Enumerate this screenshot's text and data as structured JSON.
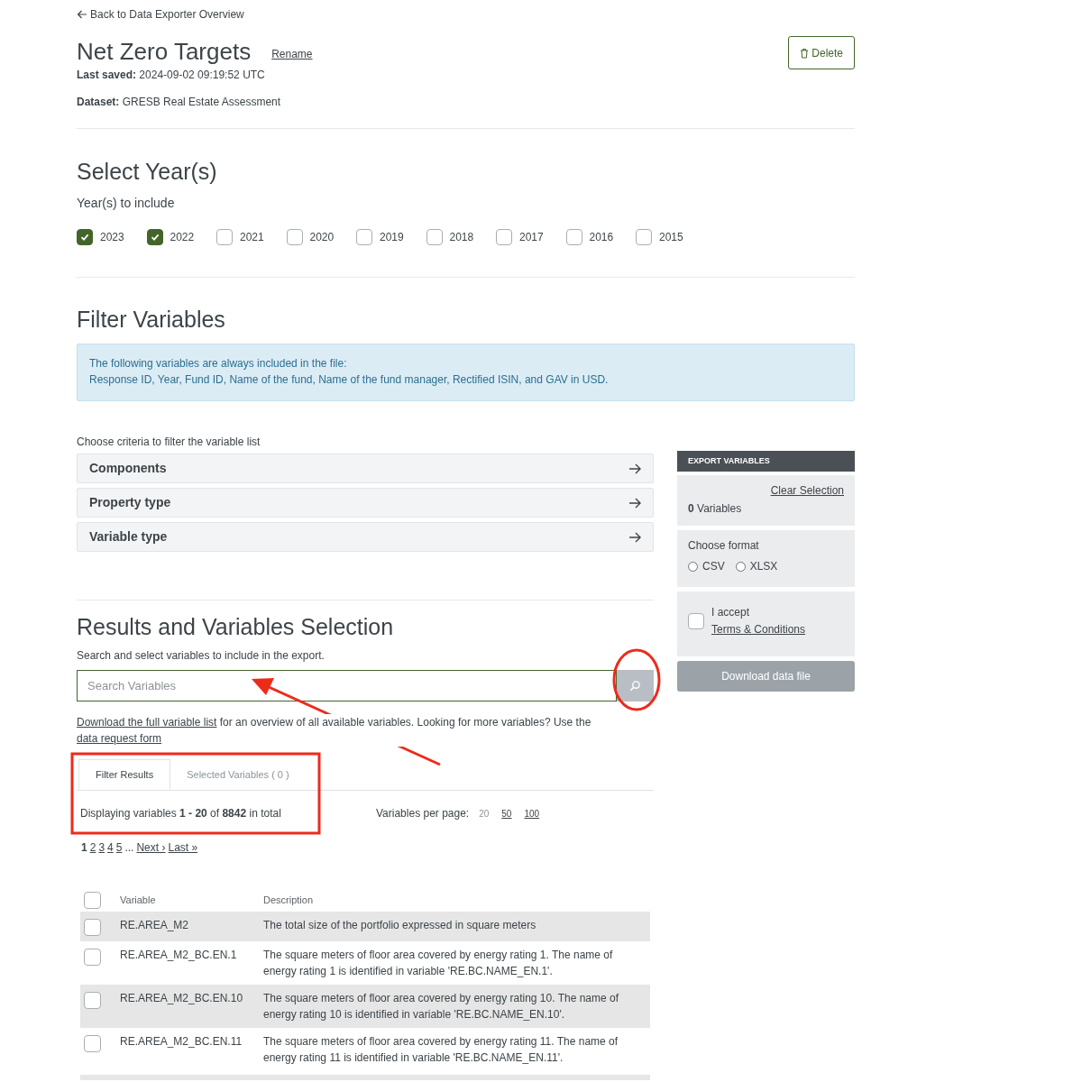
{
  "back_link": "Back to Data Exporter Overview",
  "header": {
    "title": "Net Zero Targets",
    "rename": "Rename",
    "last_saved_label": "Last saved:",
    "last_saved": "2024-09-02 09:19:52 UTC",
    "dataset_label": "Dataset:",
    "dataset": "GRESB Real Estate Assessment",
    "delete": "Delete"
  },
  "years": {
    "heading": "Select Year(s)",
    "label": "Year(s) to include",
    "items": [
      {
        "label": "2023",
        "checked": true
      },
      {
        "label": "2022",
        "checked": true
      },
      {
        "label": "2021",
        "checked": false
      },
      {
        "label": "2020",
        "checked": false
      },
      {
        "label": "2019",
        "checked": false
      },
      {
        "label": "2018",
        "checked": false
      },
      {
        "label": "2017",
        "checked": false
      },
      {
        "label": "2016",
        "checked": false
      },
      {
        "label": "2015",
        "checked": false
      }
    ]
  },
  "filter": {
    "heading": "Filter Variables",
    "info_lines": [
      "The following variables are always included in the file:",
      "Response ID, Year, Fund ID, Name of the fund, Name of the fund manager, Rectified ISIN, and GAV in USD."
    ],
    "criteria_label": "Choose criteria to filter the variable list",
    "criteria": [
      "Components",
      "Property type",
      "Variable type"
    ]
  },
  "export": {
    "header": "EXPORT VARIABLES",
    "clear": "Clear Selection",
    "count": "0",
    "count_label": "Variables",
    "format_label": "Choose format",
    "formats": [
      {
        "label": "CSV",
        "selected": false
      },
      {
        "label": "XLSX",
        "selected": false
      }
    ],
    "accept": "I accept",
    "terms": "Terms & Conditions",
    "accepted": false,
    "download": "Download data file",
    "download_disabled": true
  },
  "results": {
    "heading": "Results and Variables Selection",
    "subtitle": "Search and select variables to include in the export.",
    "search": {
      "placeholder": "Search Variables"
    },
    "note": [
      {
        "kind": "link",
        "text": "Download the full variable list"
      },
      {
        "kind": "text",
        "text": " for an overview of all available variables. Looking for more variables? Use the "
      },
      {
        "kind": "link",
        "text": "data request form"
      }
    ],
    "tabs": [
      {
        "label": "Filter Results",
        "selected": true
      },
      {
        "label": "Selected Variables ( 0 )",
        "selected": false
      }
    ],
    "displaying": "Displaying variables **1 - 20** of **8842** in total",
    "per_page_label": "Variables per page:",
    "per_page": [
      {
        "label": "20",
        "selected": true
      },
      {
        "label": "50",
        "selected": false
      },
      {
        "label": "100",
        "selected": false
      }
    ],
    "pages": [
      {
        "label": "1",
        "selected": true
      },
      {
        "label": "2",
        "selected": false
      },
      {
        "label": "3",
        "selected": false
      },
      {
        "label": "4",
        "selected": false
      },
      {
        "label": "5",
        "selected": false
      }
    ],
    "ellipsis": "...",
    "next": "Next ›",
    "last": "Last »",
    "columns": [
      "Variable",
      "Description"
    ],
    "select_all_checked": false,
    "rows": [
      {
        "variable": "RE.AREA_M2",
        "description": "The total size of the portfolio expressed in square meters",
        "checked": false
      },
      {
        "variable": "RE.AREA_M2_BC.EN.1",
        "description": "The square meters of floor area covered by energy rating 1. The name of energy rating 1 is identified in variable 'RE.BC.NAME_EN.1'.",
        "checked": false
      },
      {
        "variable": "RE.AREA_M2_BC.EN.10",
        "description": "The square meters of floor area covered by energy rating 10. The name of energy rating 10 is identified in variable 'RE.BC.NAME_EN.10'.",
        "checked": false
      },
      {
        "variable": "RE.AREA_M2_BC.EN.11",
        "description": "The square meters of floor area covered by energy rating 11. The name of energy rating 11 is identified in variable 'RE.BC.NAME_EN.11'.",
        "checked": false
      }
    ]
  },
  "annotations": [
    {
      "kind": "circle"
    },
    {
      "kind": "arrow"
    },
    {
      "kind": "rectangle"
    }
  ]
}
